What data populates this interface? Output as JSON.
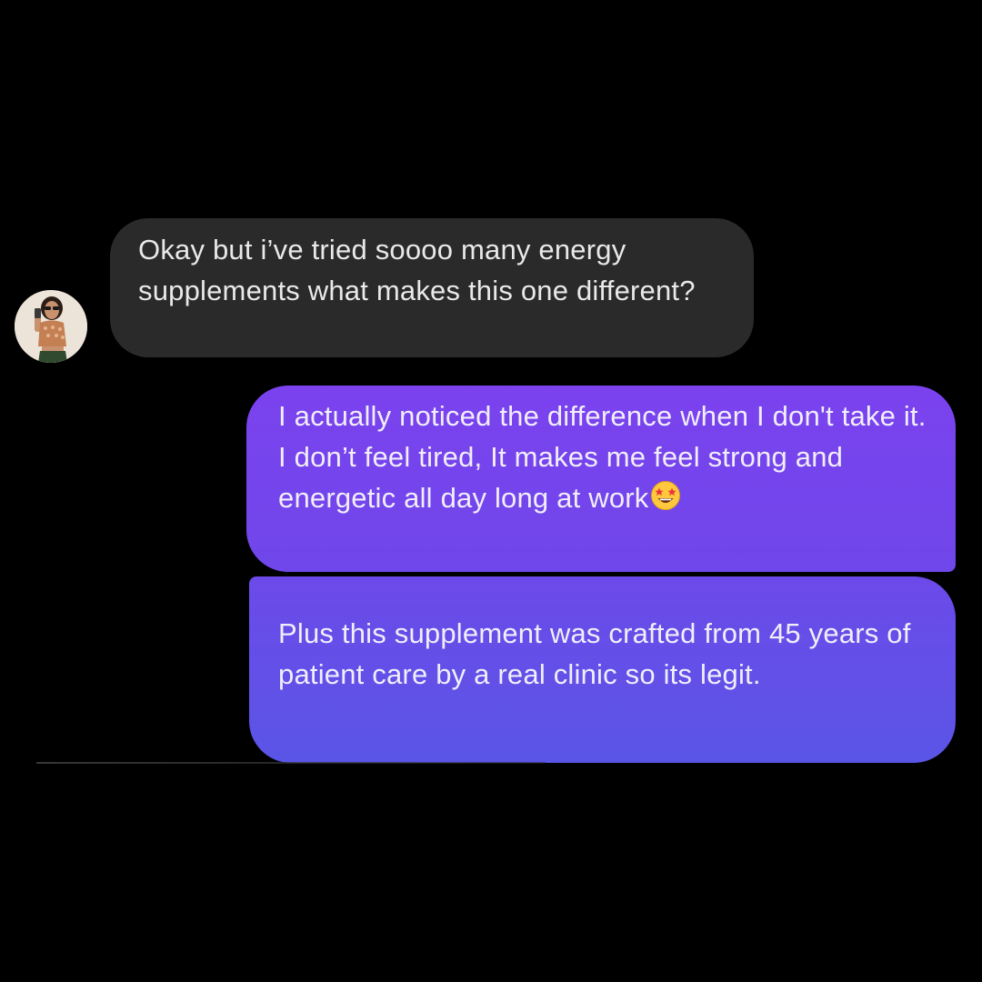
{
  "conversation": {
    "incoming": {
      "text": "Okay but i’ve tried soooo many energy supplements what makes this one different?"
    },
    "outgoing": [
      {
        "text": "I actually noticed the difference when I don't take it. I don’t feel tired, It makes me feel strong and energetic all day long at work",
        "emoji": "star-struck-emoji"
      },
      {
        "text": "Plus this supplement was crafted from 45 years of patient care by a real clinic so its legit."
      }
    ]
  },
  "colors": {
    "background": "#000000",
    "incoming_bubble": "#2a2a2a",
    "outgoing_bubble_top": "#7b42ee",
    "outgoing_bubble_bottom": "#5a55e6",
    "text": "#f1eefb"
  }
}
